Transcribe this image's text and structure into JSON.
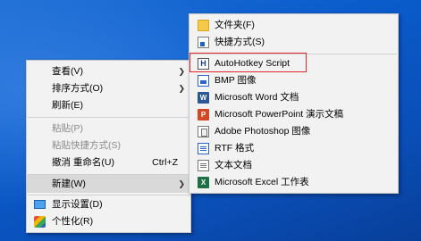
{
  "context_menu": {
    "items": [
      {
        "label": "查看(V)",
        "has_submenu": true
      },
      {
        "label": "排序方式(O)",
        "has_submenu": true
      },
      {
        "label": "刷新(E)"
      },
      {
        "label": "粘贴(P)",
        "disabled": true
      },
      {
        "label": "粘贴快捷方式(S)",
        "disabled": true
      },
      {
        "label": "撤消 重命名(U)",
        "shortcut": "Ctrl+Z"
      },
      {
        "label": "新建(W)",
        "has_submenu": true,
        "highlighted": true
      },
      {
        "label": "显示设置(D)",
        "icon": "display-icon"
      },
      {
        "label": "个性化(R)",
        "icon": "personalize-icon"
      }
    ]
  },
  "new_submenu": {
    "items": [
      {
        "label": "文件夹(F)",
        "icon": "folder-icon"
      },
      {
        "label": "快捷方式(S)",
        "icon": "shortcut-icon"
      },
      {
        "label": "AutoHotkey Script",
        "icon": "autohotkey-icon",
        "annotated": true
      },
      {
        "label": "BMP 图像",
        "icon": "bmp-image-icon"
      },
      {
        "label": "Microsoft Word 文档",
        "icon": "word-icon"
      },
      {
        "label": "Microsoft PowerPoint 演示文稿",
        "icon": "powerpoint-icon"
      },
      {
        "label": "Adobe Photoshop 图像",
        "icon": "photoshop-icon"
      },
      {
        "label": "RTF 格式",
        "icon": "rtf-icon"
      },
      {
        "label": "文本文档",
        "icon": "text-document-icon"
      },
      {
        "label": "Microsoft Excel 工作表",
        "icon": "excel-icon"
      }
    ]
  },
  "icon_glyphs": {
    "autohotkey": "H",
    "word": "W",
    "powerpoint": "P",
    "excel": "X"
  },
  "colors": {
    "desktop": "#0a5ccc",
    "menu_bg": "#f2f2f2",
    "hover": "#d9d9d9",
    "annotation_red": "#e0262b"
  }
}
